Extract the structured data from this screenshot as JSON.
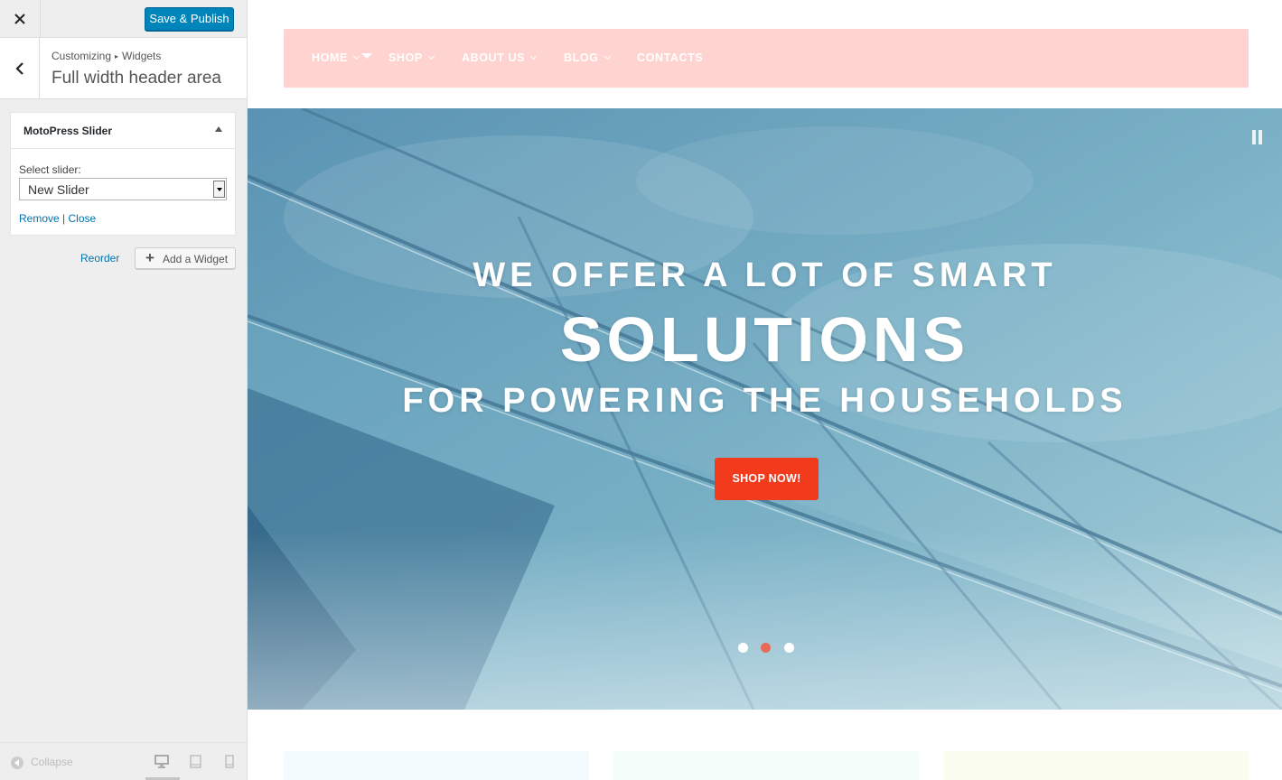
{
  "customizer": {
    "close_icon": "close-icon",
    "save_button": "Save & Publish",
    "breadcrumb": [
      "Customizing",
      "Widgets"
    ],
    "breadcrumb_separator": "▸",
    "section_title": "Full width header area",
    "widget": {
      "title": "MotoPress Slider",
      "select_label": "Select slider:",
      "selected_slider": "New Slider",
      "remove_link": "Remove",
      "link_separator": "|",
      "close_link": "Close"
    },
    "reorder_link": "Reorder",
    "add_widget_button": "Add a Widget",
    "collapse_label": "Collapse",
    "active_device": "desktop",
    "colors": {
      "primary": "#0085ba",
      "link": "#0073aa"
    }
  },
  "site": {
    "nav": [
      {
        "label": "HOME",
        "has_dropdown": true
      },
      {
        "label": "SHOP",
        "has_dropdown": true
      },
      {
        "label": "ABOUT US",
        "has_dropdown": true
      },
      {
        "label": "BLOG",
        "has_dropdown": true
      },
      {
        "label": "CONTACTS",
        "has_dropdown": false
      }
    ],
    "hero": {
      "line1": "WE OFFER A LOT OF SMART",
      "line2": "SOLUTIONS",
      "line3": "FOR POWERING THE HOUSEHOLDS",
      "button": "SHOP NOW!",
      "slide_count": 3,
      "active_slide": 2
    },
    "colors": {
      "nav_bg": "#ffd3cf",
      "accent": "#f23a1d",
      "active_dot": "#e96a5a"
    }
  }
}
